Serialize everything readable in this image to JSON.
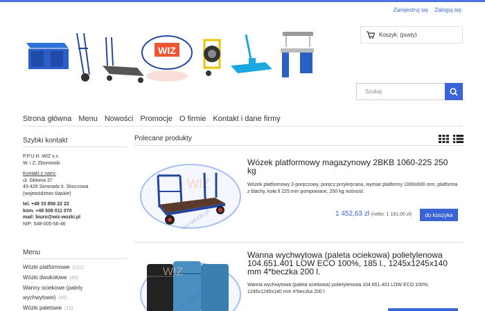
{
  "top_links": {
    "register": "Zarejestruj się",
    "login": "Zaloguj się"
  },
  "cart": {
    "label": "Koszyk: (pusty)"
  },
  "search": {
    "placeholder": "Szukaj"
  },
  "nav": [
    "Strona główna",
    "Menu",
    "Nowości",
    "Promocje",
    "O firmie",
    "Kontakt i dane firmy"
  ],
  "sidebar": {
    "contact_heading": "Szybki kontakt",
    "company": "P.P.U.H. WIZ s.c.",
    "owners": "W. i Z. Zborowski",
    "address_label": "Kontakt z nami:",
    "street": "ul. Główna 37",
    "city": "43-426 Simoradz k. Skoczowa",
    "region": "(województwo śląskie)",
    "tel": "tel. +48 33 856 22 22",
    "kom": "kom. +48 509 011 070",
    "mail": "mail: biuro@wiz-wozki.pl",
    "nip": "NIP: 548-005-56-46",
    "menu_heading": "Menu",
    "menu": [
      {
        "label": "Wózki platformowe",
        "count": "(122)"
      },
      {
        "label": "Wózki dwukołowe",
        "count": "(40)"
      },
      {
        "label": "Wanny ociekowe (palety wychwytowe)",
        "count": "(43)"
      },
      {
        "label": "Wózki paletowe",
        "count": "(15)"
      }
    ]
  },
  "main": {
    "heading": "Polecane produkty",
    "products": [
      {
        "title": "Wózek platformowy magazynowy 2BKB 1060-225 250 kg",
        "desc": "Wózek platformowy 2-poręczowy, poręcz przykręcana, wymiar platformy 1000x600 mm, platforma z blachy, koła fi 225 mm pompowane, 250 kg nośność",
        "price": "1 452,63 zł",
        "net": "(netto: 1 181,00 zł)",
        "button": "do koszyka"
      },
      {
        "title": "Wanna wychwytowa (paleta ociekowa) polietylenowa 104.651.401 LOW ECO 100%, 185 l., 1245x1245x140 mm 4*beczka 200 l.",
        "desc": "Wanna wychwytowa (paleta ociekowa) polietylenowa 104.651.401 LOW ECO 100%, 1245x1245x140 mm 4*beczka 200 l."
      }
    ]
  },
  "banner": {
    "logo_text": "WIZ"
  },
  "watermark": "www.wiz-wozki.pl",
  "colors": {
    "accent": "#3b63d8",
    "topbar": "#4d72e3"
  }
}
